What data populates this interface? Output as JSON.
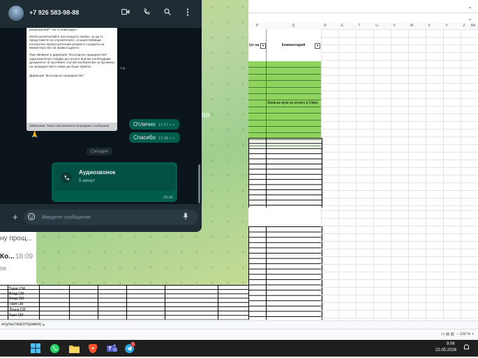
{
  "whatsapp": {
    "contact": "+7 926 583-98-88",
    "doc_lines": [
      "разрешения!\" час в неватаден.",
      "Моля разпечатайте настоящото писмо, за да го представите на служителите, осъществяващи контролно-пропускателния режим в сградата на Министерство на правосъдието.",
      "При явяване в дирекция \"Българско гражданство\" задължително следва да носите всички необходими документи. В противен случай молбата Ви за промяна на гражданството няма да бъде приета.",
      "Дирекция \"Българско гражданство\""
    ],
    "doc_footer": "Забележка: Това е автоматично генерирано съобщение",
    "emoji": "🙏",
    "messages": [
      {
        "text": "Отлично",
        "time": "17:17",
        "ticks": "✓✓"
      },
      {
        "text": "Спасибо",
        "time": "17:18",
        "ticks": "✓✓"
      }
    ],
    "date_chip": "Сегодня",
    "call": {
      "title": "Аудиозвонок",
      "subtitle": "5 минут",
      "time": "09:06"
    },
    "input_placeholder": "Введите сообщение",
    "icons": {
      "video": "video-icon",
      "call": "phone-icon",
      "search": "search-icon",
      "menu": "more-vertical-icon",
      "plus": "plus-icon",
      "sticker": "sticker-icon",
      "mic": "mic-icon"
    }
  },
  "telegram_back": {
    "partial_text_1": "ну прощ...",
    "partial_name": "Ко...",
    "partial_time": "18:09",
    "partial_text_2": "ок",
    "side_letters": "ЯЯ"
  },
  "spreadsheet": {
    "columns": [
      "P",
      "Q",
      "R",
      "S",
      "T",
      "U",
      "V",
      "W",
      "X",
      "Y",
      "Z",
      "AA"
    ],
    "header_cells": [
      "(от на",
      "Комментарий"
    ],
    "green_note": "Записан муж на оплату в Офис",
    "names": [
      "Тарас СМ",
      "Влад СМ",
      "Влад СМ",
      "Таня СМ",
      "Лиана СМ",
      "Таня СМ"
    ],
    "sheet_tab": "нсульства(отправки)",
    "zoom": "100 %"
  },
  "taskbar": {
    "time": "9:06",
    "date": "22.05.2026",
    "badge": "1",
    "apps": [
      "windows-start-icon",
      "whatsapp-icon",
      "file-explorer-icon",
      "brave-browser-icon",
      "teams-icon",
      "telegram-icon"
    ]
  },
  "colors": {
    "wa_bg": "#0b141a",
    "wa_header": "#202c33",
    "wa_out_bubble": "#005c4b",
    "sheet_green": "#8ed45e",
    "taskbar": "#1f1f1f"
  }
}
